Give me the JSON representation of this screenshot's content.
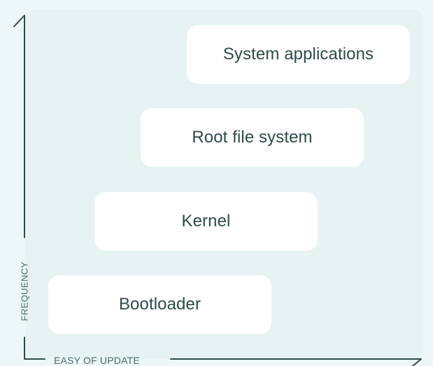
{
  "layers": [
    {
      "label": "System applications"
    },
    {
      "label": "Root file system"
    },
    {
      "label": "Kernel"
    },
    {
      "label": "Bootloader"
    }
  ],
  "axes": {
    "y_label": "FREQUENCY",
    "x_label": "EASY OF UPDATE"
  },
  "colors": {
    "background": "#edf7f7",
    "panel": "#e7f3f3",
    "box": "#ffffff",
    "text": "#2f4a4a",
    "axis": "#2f4a4a"
  }
}
